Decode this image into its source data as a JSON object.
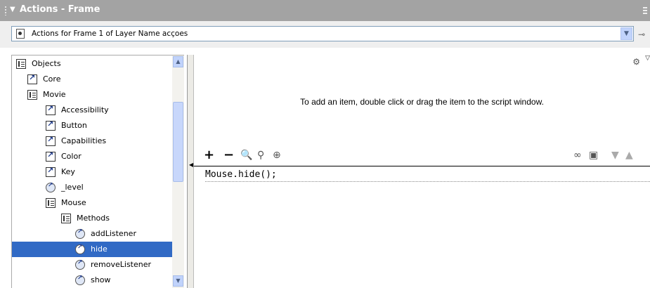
{
  "panel": {
    "title": "Actions - Frame"
  },
  "target": {
    "label": "Actions for Frame 1 of Layer Name acçoes"
  },
  "tree": {
    "items": [
      {
        "label": "Objects",
        "type": "book",
        "indent": 0
      },
      {
        "label": "Core",
        "type": "class",
        "indent": 1
      },
      {
        "label": "Movie",
        "type": "book",
        "indent": 1
      },
      {
        "label": "Accessibility",
        "type": "class",
        "indent": 2
      },
      {
        "label": "Button",
        "type": "class",
        "indent": 2
      },
      {
        "label": "Capabilities",
        "type": "class",
        "indent": 2
      },
      {
        "label": "Color",
        "type": "class",
        "indent": 2
      },
      {
        "label": "Key",
        "type": "class",
        "indent": 2
      },
      {
        "label": "_level",
        "type": "method",
        "indent": 2
      },
      {
        "label": "Mouse",
        "type": "book",
        "indent": 2
      },
      {
        "label": "Methods",
        "type": "book",
        "indent": 3
      },
      {
        "label": "addListener",
        "type": "method",
        "indent": 4
      },
      {
        "label": "hide",
        "type": "method",
        "indent": 4,
        "selected": true
      },
      {
        "label": "removeListener",
        "type": "method",
        "indent": 4
      },
      {
        "label": "show",
        "type": "method",
        "indent": 4
      }
    ]
  },
  "hint": "To add an item, double click or drag the item to the script window.",
  "toolbar": {
    "add": "+",
    "remove": "−"
  },
  "script": {
    "code": "Mouse.hide();"
  },
  "colors": {
    "titlebar": "#a3a3a3",
    "selection": "#316ac5"
  }
}
